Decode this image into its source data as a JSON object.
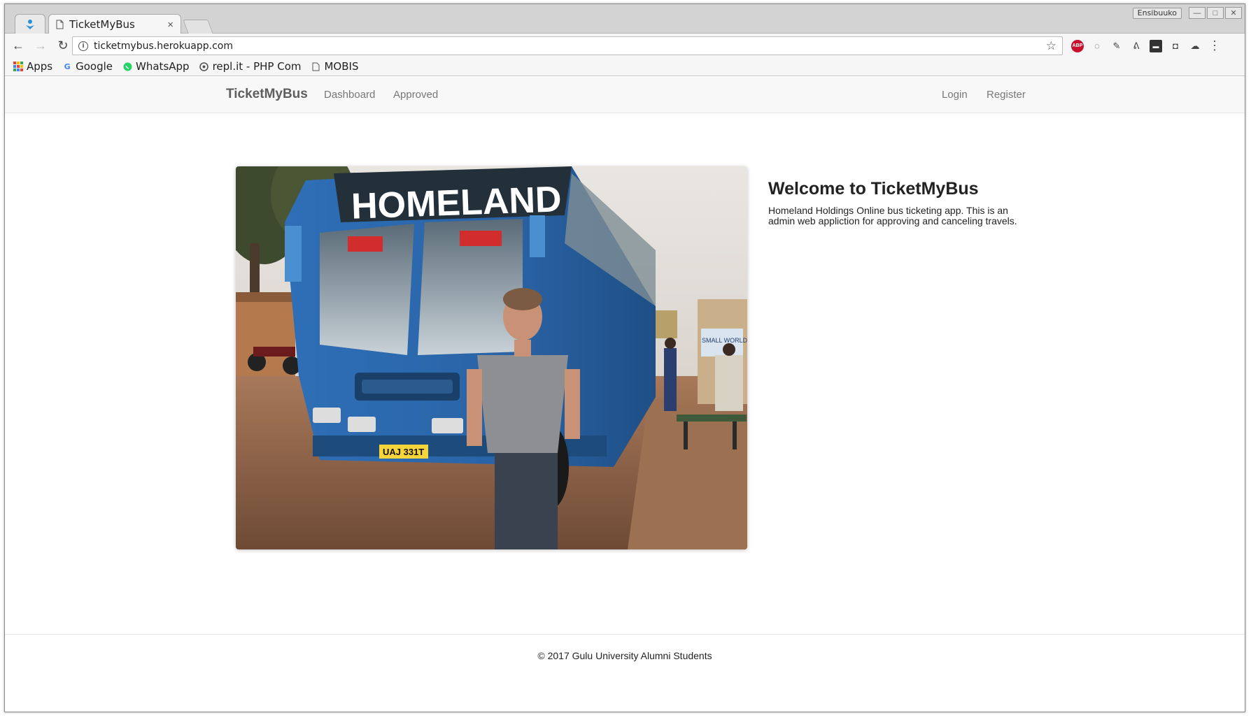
{
  "browser": {
    "tab_title": "TicketMyBus",
    "tab_close": "×",
    "profile": "Ensibuuko",
    "url": "ticketmybus.herokuapp.com",
    "back": "←",
    "forward": "→",
    "reload": "↻",
    "star": "☆",
    "menu": "⋮",
    "win_min": "—",
    "win_max": "□",
    "win_close": "✕",
    "extensions": [
      "ABP",
      "◌",
      "✎",
      "ᕕ",
      "▬",
      "◘",
      "☁"
    ]
  },
  "bookmarks": [
    {
      "label": "Apps",
      "icon": "apps-grid-icon"
    },
    {
      "label": "Google",
      "icon": "google-icon"
    },
    {
      "label": "WhatsApp",
      "icon": "whatsapp-icon"
    },
    {
      "label": "repl.it - PHP Com",
      "icon": "replit-icon"
    },
    {
      "label": "MOBIS",
      "icon": "page-icon"
    }
  ],
  "navbar": {
    "brand": "TicketMyBus",
    "links": [
      "Dashboard",
      "Approved"
    ],
    "right_links": [
      "Login",
      "Register"
    ]
  },
  "hero": {
    "image_text": "HOMELAND",
    "plate": "UAJ 331T",
    "shop_sign": "SMALL WORLD RESTAURANT"
  },
  "welcome": {
    "title": "Welcome to TicketMyBus",
    "body": "Homeland Holdings Online bus ticketing app. This is an admin web appliction for approving and canceling travels."
  },
  "footer": {
    "text": "© 2017 Gulu University Alumni Students"
  },
  "colors": {
    "navbar_bg": "#f8f8f8",
    "bus_blue": "#2b6fb3",
    "abp_red": "#c8102e",
    "whatsapp_green": "#25d366"
  }
}
